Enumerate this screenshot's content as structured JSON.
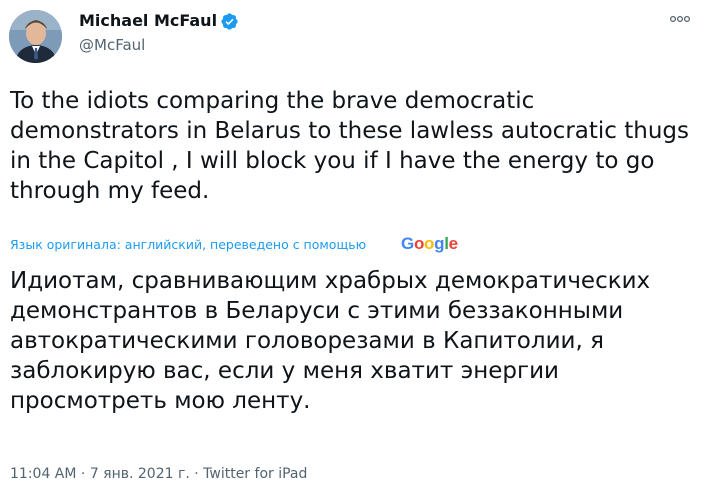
{
  "author": {
    "name": "Michael McFaul",
    "handle": "@McFaul",
    "verified": true
  },
  "tweet": {
    "text": "To the idiots comparing the brave democratic demonstrators in Belarus to these lawless autocratic thugs in the Capitol , I will block you if I have the energy to go through my feed.",
    "translation_notice": "Язык оригинала: английский, переведено с помощью",
    "translation_provider": [
      "G",
      "o",
      "o",
      "g",
      "l",
      "e"
    ],
    "translated_text": "Идиотам, сравнивающим храбрых демократических демонстрантов в Беларуси с этими беззаконными автократическими головорезами в Капитолии, я заблокирую вас, если у меня хватит энергии просмотреть мою ленту."
  },
  "meta": {
    "time": "11:04 AM",
    "separator": " · ",
    "date": "7 янв. 2021 г.",
    "source": "Twitter for iPad"
  },
  "icons": {
    "verified": "verified-badge-icon",
    "more": "more-options-icon"
  },
  "colors": {
    "text": "#0f1419",
    "secondary": "#536471",
    "link": "#1d9bf0",
    "verified": "#1d9bf0",
    "google_blue": "#4285f4",
    "google_red": "#ea4335",
    "google_yellow": "#fbbc05",
    "google_green": "#34a853"
  }
}
